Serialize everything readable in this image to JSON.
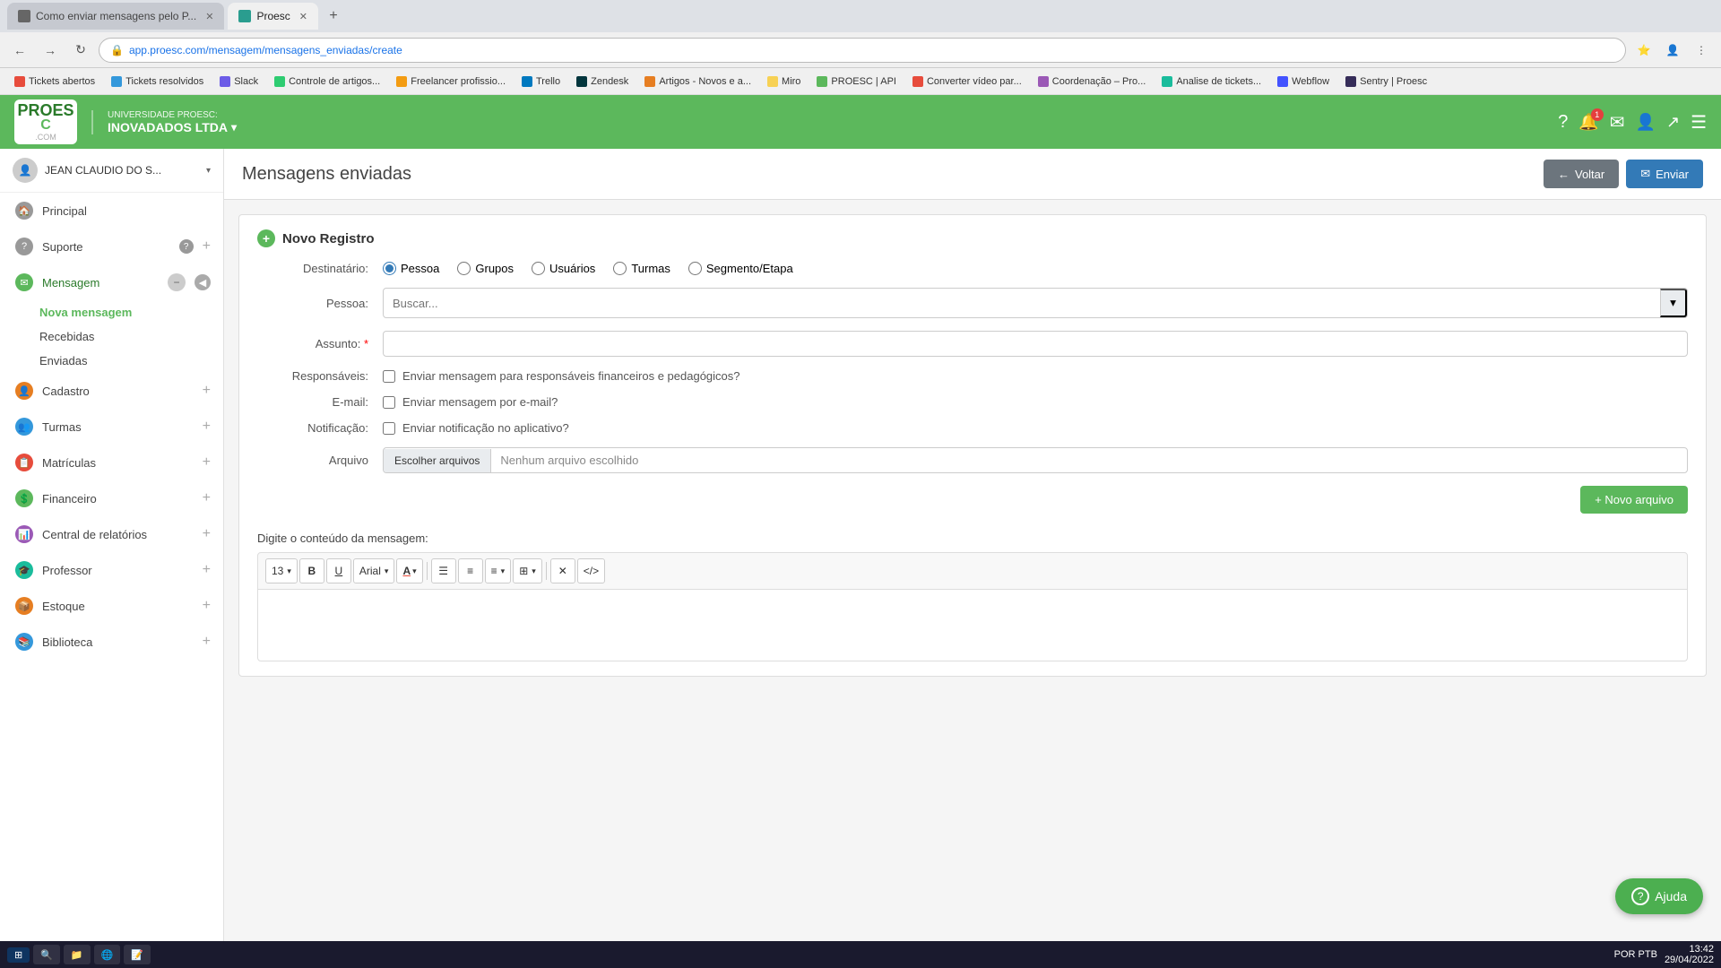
{
  "browser": {
    "tabs": [
      {
        "id": "tab1",
        "title": "Como enviar mensagens pelo P...",
        "favicon": "grey",
        "active": false
      },
      {
        "id": "tab2",
        "title": "Proesc",
        "favicon": "proesc",
        "active": true
      }
    ],
    "url": "app.proesc.com/mensagem/mensagens_enviadas/create",
    "bookmarks": [
      {
        "label": "Tickets abertos"
      },
      {
        "label": "Tickets resolvidos"
      },
      {
        "label": "Slack"
      },
      {
        "label": "Controle de artigos..."
      },
      {
        "label": "Freelancer profissio..."
      },
      {
        "label": "Trello"
      },
      {
        "label": "Zendesk"
      },
      {
        "label": "Artigos - Novos e a..."
      },
      {
        "label": "Miro"
      },
      {
        "label": "PROESC | API"
      },
      {
        "label": "Converter vídeo par..."
      },
      {
        "label": "Coordenação – Pro..."
      },
      {
        "label": "Analise de tickets..."
      },
      {
        "label": "Webflow"
      },
      {
        "label": "Sentry | Proesc"
      }
    ]
  },
  "app": {
    "logo_text": "PROES",
    "logo_sub": "C",
    "logo_com": ".COM",
    "university_label": "UNIVERSIDADE PROESC:",
    "university_name": "INOVADADOS LTDA",
    "notification_count": "1"
  },
  "sidebar": {
    "user_name": "JEAN CLAUDIO DO S...",
    "items": [
      {
        "id": "principal",
        "label": "Principal",
        "icon": "🏠",
        "icon_color": "gray"
      },
      {
        "id": "suporte",
        "label": "Suporte",
        "icon": "?",
        "icon_color": "gray",
        "has_expand": true,
        "has_help": true
      },
      {
        "id": "mensagem",
        "label": "Mensagem",
        "icon": "✉",
        "icon_color": "green",
        "expanded": true
      },
      {
        "id": "nova-mensagem",
        "label": "Nova mensagem",
        "sub": true,
        "active": true
      },
      {
        "id": "recebidas",
        "label": "Recebidas",
        "sub": true
      },
      {
        "id": "enviadas",
        "label": "Enviadas",
        "sub": true
      },
      {
        "id": "cadastro",
        "label": "Cadastro",
        "icon": "👤",
        "icon_color": "orange",
        "has_expand": true
      },
      {
        "id": "turmas",
        "label": "Turmas",
        "icon": "👥",
        "icon_color": "blue",
        "has_expand": true
      },
      {
        "id": "matriculas",
        "label": "Matrículas",
        "icon": "📋",
        "icon_color": "red",
        "has_expand": true
      },
      {
        "id": "financeiro",
        "label": "Financeiro",
        "icon": "💰",
        "icon_color": "green",
        "has_expand": true
      },
      {
        "id": "central-relatorios",
        "label": "Central de relatórios",
        "icon": "📊",
        "icon_color": "purple",
        "has_expand": true
      },
      {
        "id": "professor",
        "label": "Professor",
        "icon": "👨‍🏫",
        "icon_color": "teal",
        "has_expand": true
      },
      {
        "id": "estoque",
        "label": "Estoque",
        "icon": "📦",
        "icon_color": "orange",
        "has_expand": true
      },
      {
        "id": "biblioteca",
        "label": "Biblioteca",
        "icon": "📚",
        "icon_color": "blue",
        "has_expand": true
      }
    ]
  },
  "main": {
    "title": "Mensagens enviadas",
    "back_btn": "Voltar",
    "send_btn": "Enviar",
    "form": {
      "panel_title": "Novo Registro",
      "destinatario_label": "Destinatário:",
      "radio_options": [
        {
          "id": "pessoa",
          "label": "Pessoa",
          "checked": true
        },
        {
          "id": "grupos",
          "label": "Grupos",
          "checked": false
        },
        {
          "id": "usuarios",
          "label": "Usuários",
          "checked": false
        },
        {
          "id": "turmas",
          "label": "Turmas",
          "checked": false
        },
        {
          "id": "segmento",
          "label": "Segmento/Etapa",
          "checked": false
        }
      ],
      "pessoa_label": "Pessoa:",
      "pessoa_placeholder": "Buscar...",
      "assunto_label": "Assunto:",
      "assunto_required": true,
      "responsaveis_label": "Responsáveis:",
      "responsaveis_checkbox": "Enviar mensagem para responsáveis financeiros e pedagógicos?",
      "email_label": "E-mail:",
      "email_checkbox": "Enviar mensagem por e-mail?",
      "notificacao_label": "Notificação:",
      "notificacao_checkbox": "Enviar notificação no aplicativo?",
      "arquivo_label": "Arquivo",
      "arquivo_btn": "Escolher arquivos",
      "arquivo_none": "Nenhum arquivo escolhido",
      "novo_arquivo_btn": "+ Novo arquivo",
      "message_content_label": "Digite o conteúdo da mensagem:",
      "toolbar": {
        "font_size": "13",
        "bold": "B",
        "underline": "U",
        "font": "Arial",
        "font_color": "A",
        "list_ul": "☰",
        "list_ol": "≡",
        "align": "≡",
        "table": "⊞",
        "eraser": "✕",
        "code": "</>"
      }
    }
  },
  "ajuda": {
    "label": "Ajuda"
  },
  "taskbar": {
    "clock": "13:42",
    "date": "29/04/2022",
    "language": "POR PTB"
  }
}
